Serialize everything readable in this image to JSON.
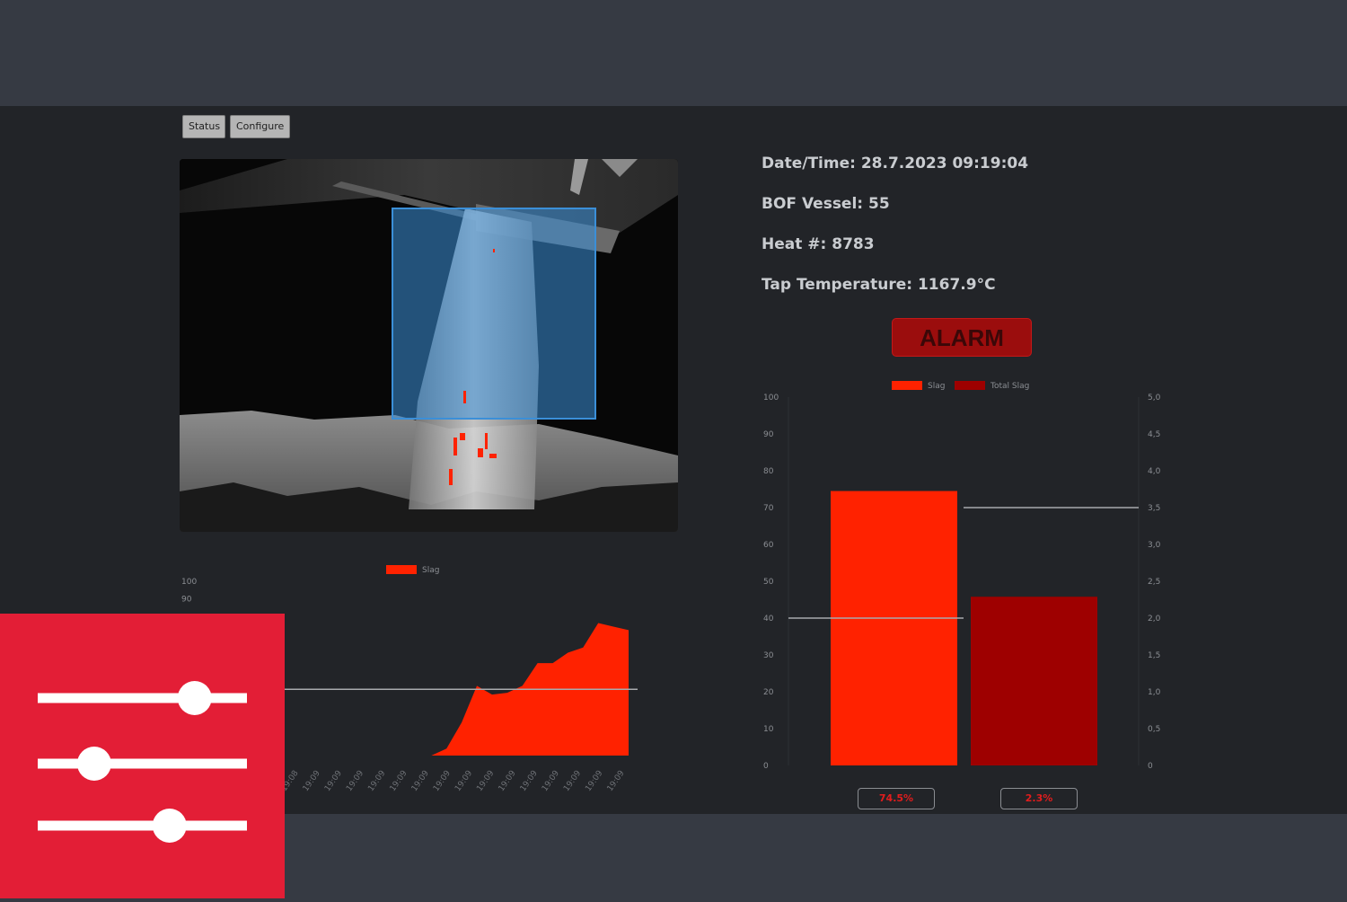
{
  "toolbar": {
    "status_label": "Status",
    "configure_label": "Configure"
  },
  "info": {
    "datetime_label": "Date/Time:",
    "datetime_value": "28.7.2023 09:19:04",
    "vessel_label": "BOF Vessel:",
    "vessel_value": "55",
    "heat_label": "Heat #:",
    "heat_value": "8783",
    "temp_label": "Tap Temperature:",
    "temp_value": "1167.9°C"
  },
  "alarm": {
    "label": "ALARM",
    "color": "#9b0d0d"
  },
  "camera": {
    "icon": "slag-detection-camera-feed",
    "roi_color": "#3b8fd8",
    "slag_color": "#ff2200"
  },
  "values": {
    "slag_percent": "74.5%",
    "total_slag_percent": "2.3%"
  },
  "overlay": {
    "icon": "sliders-settings-icon",
    "color": "#e31e36",
    "slider_levels": [
      0.75,
      0.27,
      0.63
    ]
  },
  "chart_data": [
    {
      "type": "area",
      "legend": [
        "Slag"
      ],
      "series": [
        {
          "name": "Slag",
          "color": "#ff2200",
          "values": [
            0,
            0,
            0,
            0,
            0,
            0,
            0,
            0,
            0,
            0,
            0,
            0,
            0,
            0,
            0,
            0,
            0,
            4,
            19,
            40,
            35,
            36,
            40,
            53,
            53,
            59,
            62,
            76,
            74,
            72
          ]
        }
      ],
      "y_ticks": [
        "100",
        "90"
      ],
      "x_tick_labels": [
        "19:08",
        "19:08",
        "19:09",
        "19:09",
        "19:09",
        "19:09",
        "19:09",
        "19:09",
        "19:09",
        "19:09",
        "19:09",
        "19:09",
        "19:09",
        "19:09",
        "19:09",
        "19:09",
        "19:09"
      ],
      "ylim": [
        0,
        100
      ],
      "threshold": 38
    },
    {
      "type": "bar",
      "legend": [
        "Slag",
        "Total Slag"
      ],
      "series": [
        {
          "name": "Slag",
          "color": "#ff2200",
          "value": 74.5,
          "axis": "left"
        },
        {
          "name": "Total Slag",
          "color": "#9e0000",
          "value": 2.3,
          "axis": "right"
        }
      ],
      "y_left_ticks": [
        "0",
        "10",
        "20",
        "30",
        "40",
        "50",
        "60",
        "70",
        "80",
        "90",
        "100"
      ],
      "y_right_ticks": [
        "0",
        "0,5",
        "1,0",
        "1,5",
        "2,0",
        "2,5",
        "3,0",
        "3,5",
        "4,0",
        "4,5",
        "5,0"
      ],
      "ylim_left": [
        0,
        100
      ],
      "ylim_right": [
        0,
        5
      ],
      "threshold_left": 40,
      "threshold_right": 3.5
    }
  ]
}
